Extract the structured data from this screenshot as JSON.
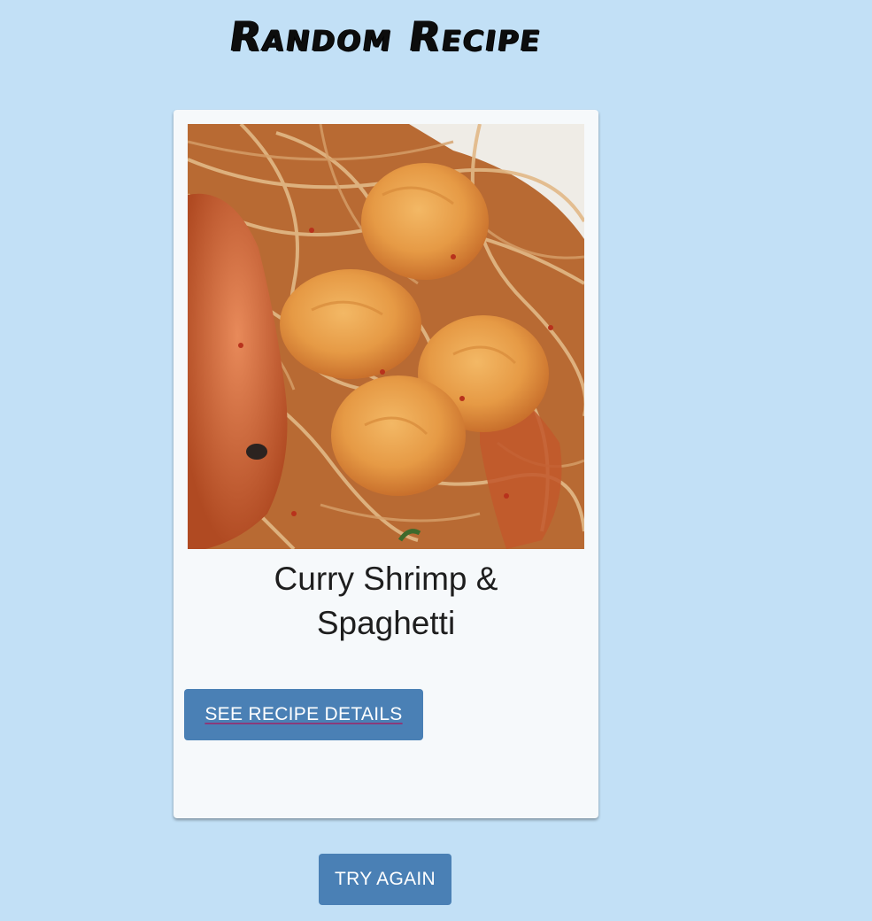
{
  "header": {
    "title": "Random Recipe"
  },
  "recipe": {
    "name": "Curry Shrimp & Spaghetti",
    "details_label": "SEE RECIPE DETAILS"
  },
  "actions": {
    "try_again_label": "TRY AGAIN"
  },
  "colors": {
    "background": "#c2e0f6",
    "card": "#f6f9fb",
    "button": "#4a80b5"
  }
}
